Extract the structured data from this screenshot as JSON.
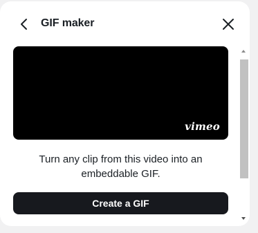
{
  "header": {
    "title": "GIF maker",
    "back_icon": "chevron-left-icon",
    "close_icon": "close-icon"
  },
  "video": {
    "logo_text": "vimeo"
  },
  "description": "Turn any clip from this video into an embeddable GIF.",
  "actions": {
    "create_label": "Create a GIF"
  },
  "colors": {
    "background": "#f1f1f2",
    "panel": "#ffffff",
    "button": "#17191e",
    "text": "#1a1f24"
  }
}
